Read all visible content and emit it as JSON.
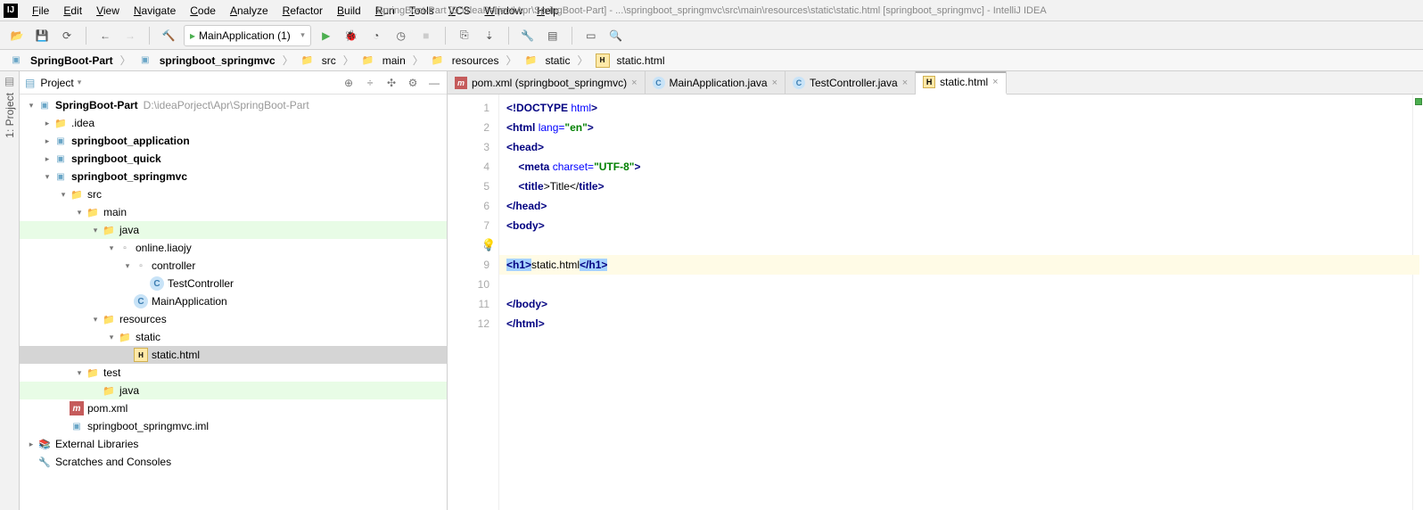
{
  "window_title": "SpringBoot-Part [D:\\ideaPorject\\Apr\\SpringBoot-Part] - ...\\springboot_springmvc\\src\\main\\resources\\static\\static.html [springboot_springmvc] - IntelliJ IDEA",
  "menu": [
    "File",
    "Edit",
    "View",
    "Navigate",
    "Code",
    "Analyze",
    "Refactor",
    "Build",
    "Run",
    "Tools",
    "VCS",
    "Window",
    "Help"
  ],
  "run_config": "MainApplication (1)",
  "breadcrumbs": [
    {
      "label": "SpringBoot-Part",
      "icon": "module",
      "bold": true
    },
    {
      "label": "springboot_springmvc",
      "icon": "module",
      "bold": true
    },
    {
      "label": "src",
      "icon": "folder"
    },
    {
      "label": "main",
      "icon": "folder"
    },
    {
      "label": "resources",
      "icon": "folder"
    },
    {
      "label": "static",
      "icon": "folder"
    },
    {
      "label": "static.html",
      "icon": "html"
    }
  ],
  "project_title": "Project",
  "tree": [
    {
      "depth": 0,
      "arrow": "down",
      "icon": "module",
      "label": "SpringBoot-Part",
      "path": "D:\\ideaPorject\\Apr\\SpringBoot-Part",
      "bold": true
    },
    {
      "depth": 1,
      "arrow": "right",
      "icon": "folder",
      "label": ".idea"
    },
    {
      "depth": 1,
      "arrow": "right",
      "icon": "module",
      "label": "springboot_application",
      "bold": true
    },
    {
      "depth": 1,
      "arrow": "right",
      "icon": "module",
      "label": "springboot_quick",
      "bold": true
    },
    {
      "depth": 1,
      "arrow": "down",
      "icon": "module",
      "label": "springboot_springmvc",
      "bold": true
    },
    {
      "depth": 2,
      "arrow": "down",
      "icon": "folder",
      "label": "src"
    },
    {
      "depth": 3,
      "arrow": "down",
      "icon": "folder",
      "label": "main"
    },
    {
      "depth": 4,
      "arrow": "down",
      "icon": "folder",
      "label": "java",
      "java": true
    },
    {
      "depth": 5,
      "arrow": "down",
      "icon": "pkg",
      "label": "online.liaojy"
    },
    {
      "depth": 6,
      "arrow": "down",
      "icon": "pkg",
      "label": "controller"
    },
    {
      "depth": 7,
      "arrow": "none",
      "icon": "class",
      "label": "TestController"
    },
    {
      "depth": 6,
      "arrow": "none",
      "icon": "class",
      "label": "MainApplication"
    },
    {
      "depth": 4,
      "arrow": "down",
      "icon": "folder",
      "label": "resources"
    },
    {
      "depth": 5,
      "arrow": "down",
      "icon": "folder",
      "label": "static"
    },
    {
      "depth": 6,
      "arrow": "none",
      "icon": "html",
      "label": "static.html",
      "selected": true
    },
    {
      "depth": 3,
      "arrow": "down",
      "icon": "folder",
      "label": "test"
    },
    {
      "depth": 4,
      "arrow": "none",
      "icon": "folder",
      "label": "java",
      "java": true
    },
    {
      "depth": 2,
      "arrow": "none",
      "icon": "maven",
      "label": "pom.xml"
    },
    {
      "depth": 2,
      "arrow": "none",
      "icon": "module",
      "label": "springboot_springmvc.iml"
    },
    {
      "depth": 0,
      "arrow": "right",
      "icon": "lib",
      "label": "External Libraries"
    },
    {
      "depth": 0,
      "arrow": "none",
      "icon": "scratch",
      "label": "Scratches and Consoles"
    }
  ],
  "tabs": [
    {
      "label": "pom.xml (springboot_springmvc)",
      "icon": "maven",
      "active": false
    },
    {
      "label": "MainApplication.java",
      "icon": "class",
      "active": false
    },
    {
      "label": "TestController.java",
      "icon": "class",
      "active": false
    },
    {
      "label": "static.html",
      "icon": "html",
      "active": true
    }
  ],
  "gutter_lines": [
    "1",
    "2",
    "3",
    "4",
    "5",
    "6",
    "7",
    "8",
    "9",
    "10",
    "11",
    "12"
  ],
  "left_tab": "1: Project",
  "code": {
    "l1_a": "<!DOCTYPE ",
    "l1_b": "html",
    "l1_c": ">",
    "l2_a": "<",
    "l2_b": "html ",
    "l2_c": "lang=",
    "l2_d": "\"en\"",
    "l2_e": ">",
    "l3_a": "<",
    "l3_b": "head",
    "l3_c": ">",
    "l4_a": "    <",
    "l4_b": "meta ",
    "l4_c": "charset=",
    "l4_d": "\"UTF-8\"",
    "l4_e": ">",
    "l5_a": "    <",
    "l5_b": "title",
    "l5_c": ">Title</",
    "l5_d": "title",
    "l5_e": ">",
    "l6_a": "</",
    "l6_b": "head",
    "l6_c": ">",
    "l7_a": "<",
    "l7_b": "body",
    "l7_c": ">",
    "l9_a": "<",
    "l9_b": "h1",
    "l9_c": ">",
    "l9_d": "static.html",
    "l9_e": "</",
    "l9_f": "h1",
    "l9_g": ">",
    "l11_a": "</",
    "l11_b": "body",
    "l11_c": ">",
    "l12_a": "</",
    "l12_b": "html",
    "l12_c": ">"
  }
}
